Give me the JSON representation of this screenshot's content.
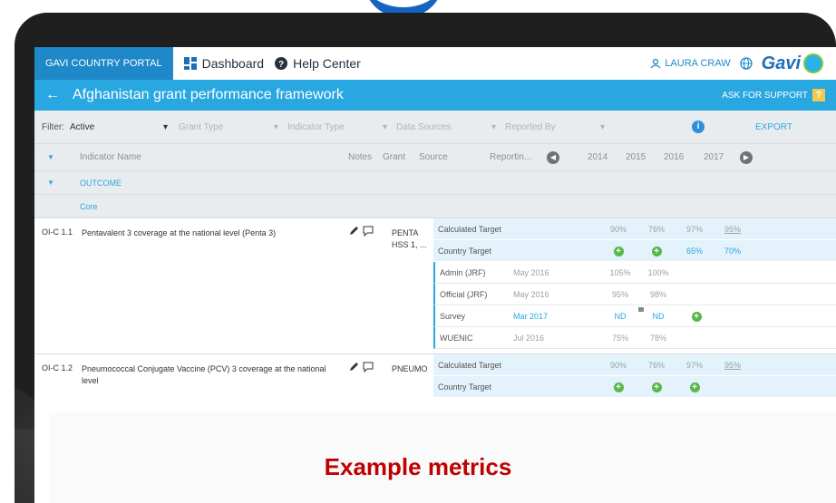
{
  "portal": {
    "tab_label": "GAVI COUNTRY PORTAL",
    "nav": [
      {
        "label": "Dashboard",
        "icon": "dashboard-icon"
      },
      {
        "label": "Help Center",
        "icon": "help-icon"
      }
    ],
    "user": "LAURA CRAW",
    "brand": "Gavi"
  },
  "titlebar": {
    "title": "Afghanistan grant performance framework",
    "support_label": "ASK FOR SUPPORT",
    "support_icon": "?"
  },
  "filters": {
    "label": "Filter:",
    "active_value": "Active",
    "grant_type": "Grant Type",
    "indicator_type": "Indicator Type",
    "data_sources": "Data Sources",
    "reported_by": "Reported By",
    "export_label": "EXPORT"
  },
  "columns": {
    "indicator_name": "Indicator Name",
    "notes": "Notes",
    "grant": "Grant",
    "source": "Source",
    "reporting": "Reportin...",
    "years": [
      "2014",
      "2015",
      "2016",
      "2017"
    ]
  },
  "group": {
    "outcome": "OUTCOME",
    "core": "Core"
  },
  "indicators": [
    {
      "code": "OI-C 1.1",
      "name": "Pentavalent 3 coverage at the national level (Penta 3)",
      "grant": "PENTA HSS 1, ...",
      "rows": [
        {
          "type": "target",
          "source": "Calculated Target",
          "date": "",
          "v2014": "90%",
          "v2015": "76%",
          "v2016": "97%",
          "v2017": "95%"
        },
        {
          "type": "target",
          "source": "Country Target",
          "date": "",
          "v2014": "+",
          "v2015": "+",
          "v2016": "65%",
          "v2017": "70%"
        },
        {
          "type": "report",
          "source": "Admin (JRF)",
          "date": "May 2016",
          "v2014": "105%",
          "v2015": "100%",
          "v2016": "",
          "v2017": ""
        },
        {
          "type": "report",
          "source": "Official (JRF)",
          "date": "May 2016",
          "v2014": "95%",
          "v2015": "98%",
          "v2016": "",
          "v2017": ""
        },
        {
          "type": "report",
          "source": "Survey",
          "date": "Mar 2017",
          "v2014": "ND",
          "v2015": "ND",
          "v2016": "+",
          "v2017": ""
        },
        {
          "type": "report",
          "source": "WUENIC",
          "date": "Jul 2016",
          "v2014": "75%",
          "v2015": "78%",
          "v2016": "",
          "v2017": ""
        }
      ]
    },
    {
      "code": "OI-C 1.2",
      "name": "Pneumococcal Conjugate Vaccine (PCV) 3 coverage at the national level",
      "grant": "PNEUMO",
      "rows": [
        {
          "type": "target",
          "source": "Calculated Target",
          "date": "",
          "v2014": "90%",
          "v2015": "76%",
          "v2016": "97%",
          "v2017": "95%"
        },
        {
          "type": "target",
          "source": "Country Target",
          "date": "",
          "v2014": "+",
          "v2015": "+",
          "v2016": "+",
          "v2017": ""
        }
      ]
    }
  ],
  "caption": "Example metrics",
  "colors": {
    "portal_blue": "#1e88c8",
    "title_blue": "#29a7e1",
    "caption_red": "#c00000",
    "plus_green": "#55b848"
  }
}
